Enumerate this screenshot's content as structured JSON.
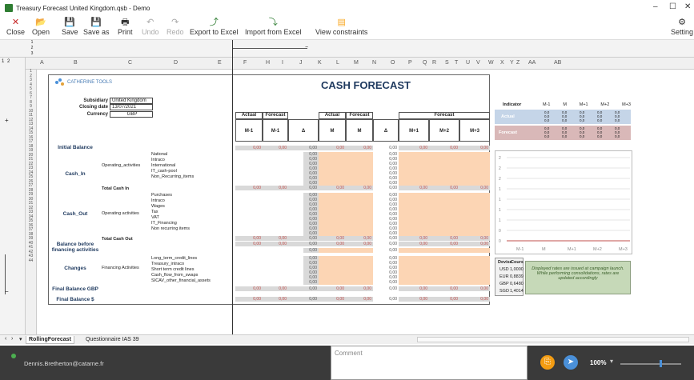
{
  "window": {
    "title": "Treasury Forecast United Kingdom.qsb - Demo",
    "controls": [
      "–",
      "☐",
      "✕"
    ]
  },
  "toolbar": {
    "items": [
      {
        "label": "Close",
        "icon": "✕"
      },
      {
        "label": "Open",
        "icon": "📂"
      },
      {
        "label": "Save",
        "icon": "💾"
      },
      {
        "label": "Save as",
        "icon": "💾"
      },
      {
        "label": "Print",
        "icon": "🖶"
      },
      {
        "label": "Undo",
        "icon": "↶"
      },
      {
        "label": "Redo",
        "icon": "↷"
      },
      {
        "label": "Export to Excel",
        "icon": "⤴"
      },
      {
        "label": "Import from Excel",
        "icon": "⤵"
      },
      {
        "label": "View constraints",
        "icon": "▤"
      }
    ],
    "settings": "Setting"
  },
  "outline_levels": [
    "1",
    "2"
  ],
  "outline_row_levels": [
    "1",
    "2",
    "3"
  ],
  "columns": [
    "A",
    "B",
    "C",
    "D",
    "E",
    "F",
    "H",
    "I",
    "J",
    "K",
    "L",
    "M",
    "N",
    "O",
    "P",
    "Q",
    "R",
    "S",
    "T",
    "U",
    "V",
    "W",
    "X",
    "Y",
    "Z",
    "AA",
    "AB"
  ],
  "rows": [
    "1",
    "2",
    "3",
    "4",
    "5",
    "6",
    "7",
    "8",
    "9",
    "10",
    "11",
    "12",
    "13",
    "14",
    "15",
    "16",
    "17",
    "18",
    "19",
    "20",
    "21",
    "22",
    "23",
    "24",
    "25",
    "26",
    "27",
    "28",
    "29",
    "30",
    "31",
    "32",
    "33",
    "34",
    "35",
    "36",
    "37",
    "38",
    "39",
    "40",
    "41",
    "42",
    "43",
    "44"
  ],
  "sheet": {
    "logo": "CATHERINE TOOLS",
    "title": "CASH FORECAST",
    "subsidiary_label": "Subsidiary",
    "subsidiary": "United Kingdom",
    "closing_label": "Closing date",
    "closing": "13/07/2021",
    "currency_label": "Currency",
    "currency": "GBP",
    "headers": {
      "actual": "Actual",
      "forecast": "Forecast",
      "m1": "M-1",
      "delta": "Δ",
      "m": "M",
      "mp1": "M+1",
      "mp2": "M+2",
      "mp3": "M+3"
    },
    "sections": {
      "initial": "Initial Balance",
      "cash_in": "Cash_In",
      "cash_in_sub": "Operating_activities",
      "cash_in_items": [
        "National",
        "Intraco",
        "International",
        "IT_cash-pool",
        "Non_Recurring_items"
      ],
      "total_in": "Total Cash In",
      "cash_out": "Cash_Out",
      "cash_out_sub": "Operating activities",
      "cash_out_items": [
        "Purchases",
        "Intraco",
        "Wages",
        "Tax",
        "VAT",
        "IT_Financing",
        "Non recurring items"
      ],
      "total_out": "Total Cash Out",
      "before": "Balance before financing activities",
      "changes": "Changes",
      "changes_sub": "Financing Activities",
      "changes_items": [
        "Long_term_credit_lines",
        "Treasury_intraco",
        "Short term credit lines",
        "Cash_flow_from_swaps",
        "SICAV_other_financial_assets"
      ],
      "final_gbp": "Final Balance GBP",
      "final_s": "Final Balance $"
    },
    "zero": "0,00"
  },
  "indicator": {
    "title": "Indicator",
    "cols": [
      "M-1",
      "M",
      "M+1",
      "M+2",
      "M+3"
    ],
    "actual": "Actual",
    "forecast": "Forecast",
    "val": "0,0"
  },
  "chart_axis": [
    "2",
    "2",
    "2",
    "1",
    "1",
    "1",
    "1",
    "0",
    "0"
  ],
  "chart_x": [
    "M-1",
    "M",
    "M+1",
    "M+2",
    "M+3"
  ],
  "currencies": {
    "head": [
      "Devise",
      "Cours"
    ],
    "rows": [
      [
        "USD",
        "1,0000"
      ],
      [
        "EUR",
        "0,8839"
      ],
      [
        "GBP",
        "0,6480"
      ],
      [
        "SGD",
        "1,4014"
      ]
    ]
  },
  "note": "Displayed rates are issued at campaign launch. While performing consolidations, rates are updated accordingly",
  "tabs": [
    "RollingForecast",
    "Questionnaire IAS 39"
  ],
  "status": {
    "email": "Dennis.Bretherton@catarne.fr",
    "comment": "Comment",
    "zoom": "100%"
  }
}
